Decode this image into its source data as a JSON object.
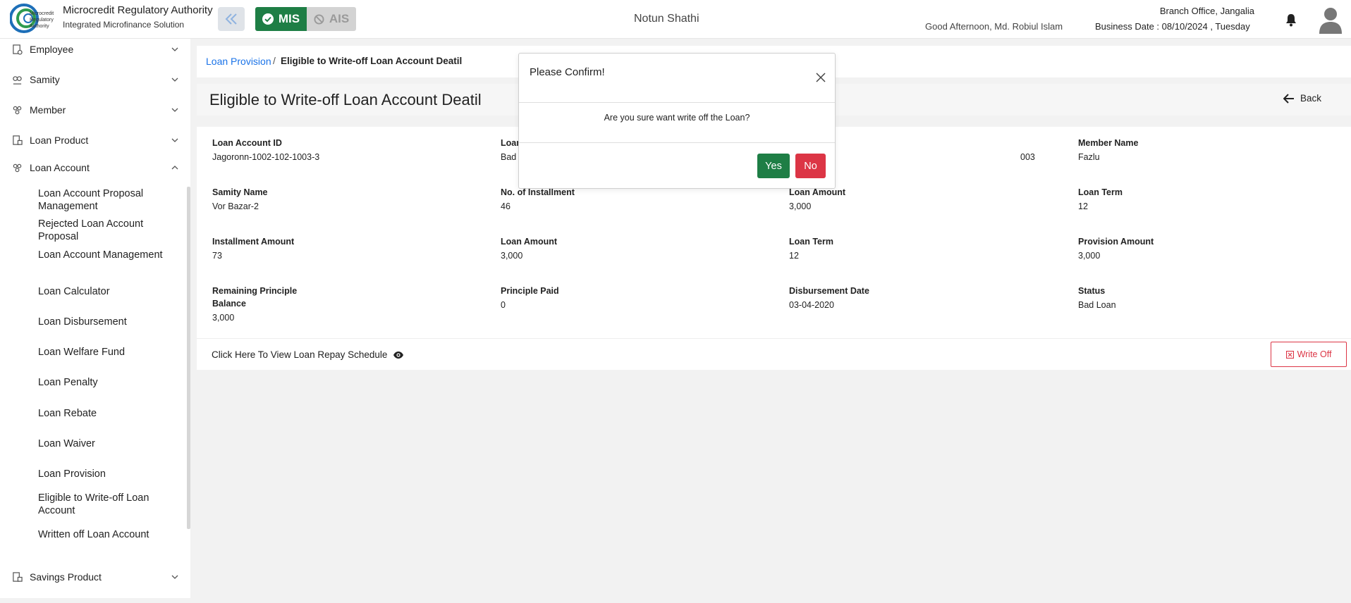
{
  "header": {
    "org_name": "Microcredit Regulatory Authority",
    "org_subtitle": "Integrated Microfinance Solution",
    "logo_text": [
      "Microcredit",
      "Regulatory",
      "Authority"
    ],
    "mis_label": "MIS",
    "ais_label": "AIS",
    "app_title": "Notun Shathi",
    "greeting": "Good Afternoon, Md. Robiul Islam",
    "branch": "Branch Office, Jangalia",
    "business_date": "Business Date : 08/10/2024 , Tuesday",
    "colors": {
      "primary_green": "#1e7e45",
      "danger_red": "#dc3545",
      "link_blue": "#1a73e8"
    }
  },
  "sidebar": {
    "items": [
      {
        "label": "Employee",
        "icon": "employee-icon"
      },
      {
        "label": "Samity",
        "icon": "samity-icon"
      },
      {
        "label": "Member",
        "icon": "member-icon"
      },
      {
        "label": "Loan Product",
        "icon": "loan-product-icon"
      },
      {
        "label": "Loan Account",
        "icon": "loan-account-icon"
      }
    ],
    "loan_account_sub": [
      "Loan Account Proposal Management",
      "Rejected Loan Account Proposal",
      "Loan Account Management",
      "Loan Calculator",
      "Loan Disbursement",
      "Loan Welfare Fund",
      "Loan Penalty",
      "Loan Rebate",
      "Loan Waiver",
      "Loan Provision",
      "Eligible to Write-off Loan Account",
      "Written off Loan Account"
    ],
    "savings_product": "Savings Product"
  },
  "breadcrumb": {
    "parent": "Loan Provision",
    "separator": "/",
    "current": "Eligible to Write-off Loan Account Deatil"
  },
  "page": {
    "title": "Eligible to Write-off Loan Account Deatil",
    "back": "Back"
  },
  "fields": [
    {
      "label": "Loan Account ID",
      "value": "Jagoronn-1002-102-1003-3"
    },
    {
      "label": "Loan",
      "value": "Bad"
    },
    {
      "label": "",
      "value": "003"
    },
    {
      "label": "Member Name",
      "value": "Fazlu"
    },
    {
      "label": "Samity Name",
      "value": "Vor Bazar-2"
    },
    {
      "label": "No. of Installment",
      "value": "46"
    },
    {
      "label": "Loan Amount",
      "value": "3,000"
    },
    {
      "label": "Loan Term",
      "value": "12"
    },
    {
      "label": "Installment Amount",
      "value": "73"
    },
    {
      "label": "Loan Amount",
      "value": "3,000"
    },
    {
      "label": "Loan Term",
      "value": "12"
    },
    {
      "label": "Provision Amount",
      "value": "3,000"
    },
    {
      "label": "Remaining Principle Balance",
      "value": "3,000"
    },
    {
      "label": "Principle Paid",
      "value": "0"
    },
    {
      "label": "Disbursement Date",
      "value": "03-04-2020"
    },
    {
      "label": "Status",
      "value": "Bad Loan"
    }
  ],
  "footer": {
    "repay_link": "Click Here To View Loan Repay Schedule",
    "write_off": "Write Off"
  },
  "modal": {
    "title": "Please Confirm!",
    "message": "Are you sure want write off the Loan?",
    "yes": "Yes",
    "no": "No"
  }
}
